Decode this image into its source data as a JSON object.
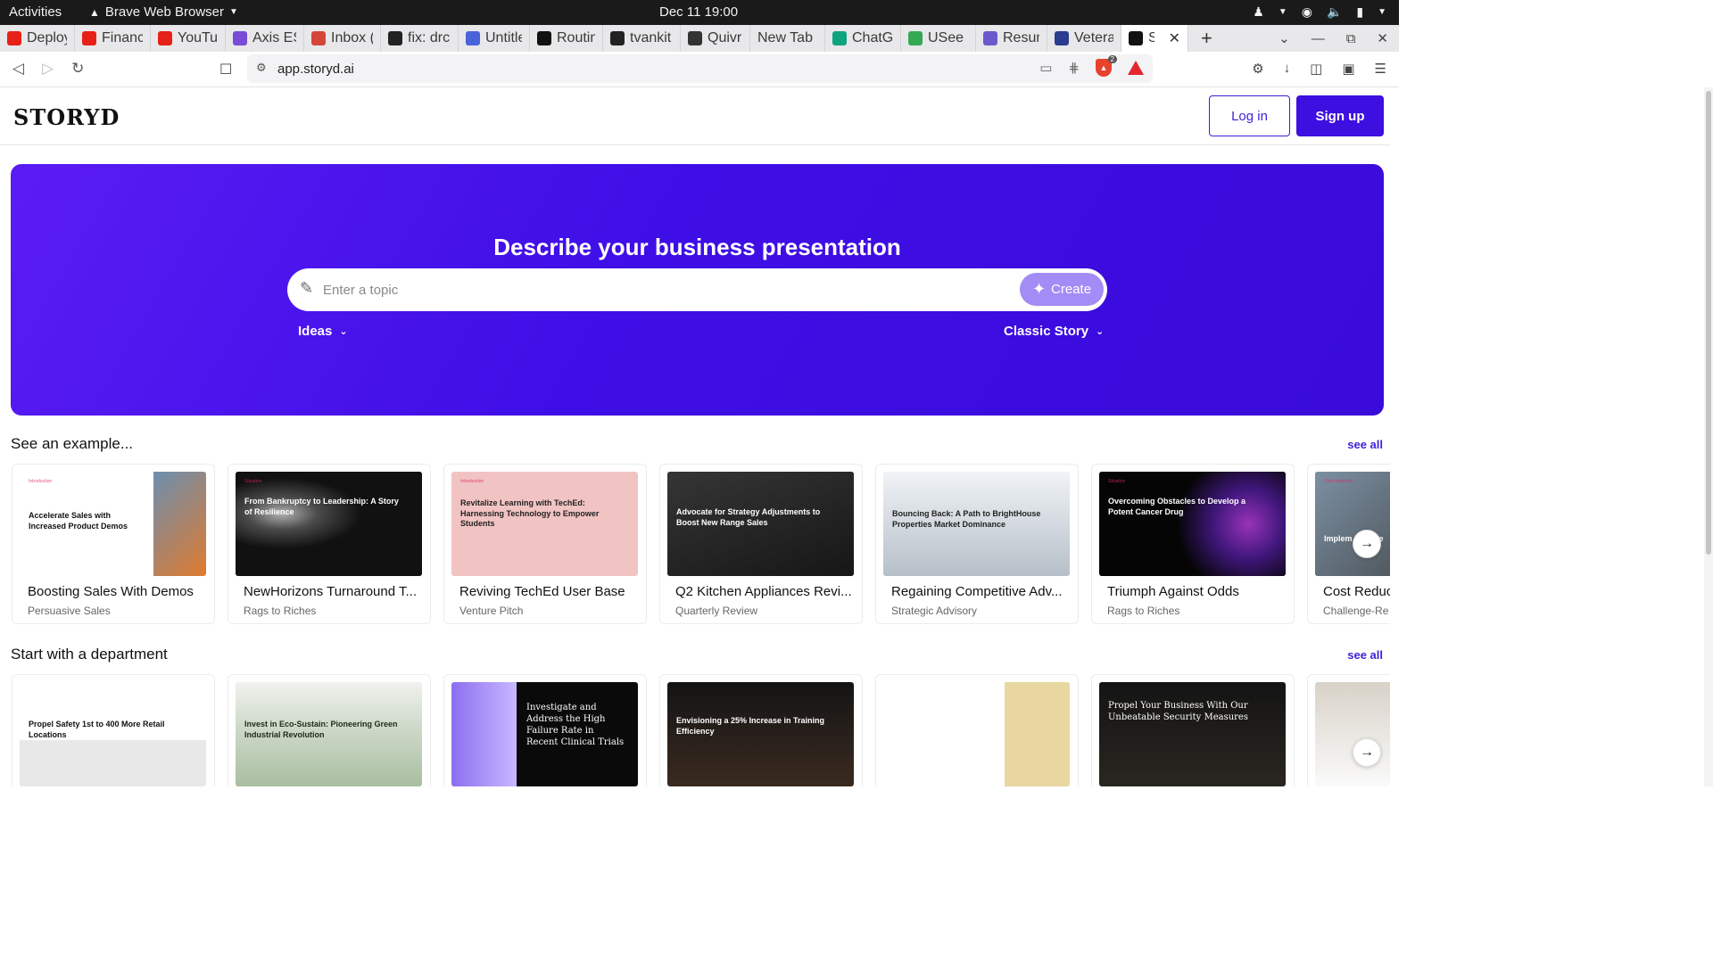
{
  "os": {
    "activities": "Activities",
    "app_name": "Brave Web Browser",
    "clock": "Dec 11  19:00"
  },
  "tabs": [
    {
      "label": "Deploy",
      "fav_color": "#e62117"
    },
    {
      "label": "Financ",
      "fav_color": "#e62117"
    },
    {
      "label": "YouTul",
      "fav_color": "#e62117"
    },
    {
      "label": "Axis ES",
      "fav_color": "#7a4bd6"
    },
    {
      "label": "Inbox (",
      "fav_color": "#d44638"
    },
    {
      "label": "fix: drc",
      "fav_color": "#222222"
    },
    {
      "label": "Untitle",
      "fav_color": "#4a63d8"
    },
    {
      "label": "Routin",
      "fav_color": "#111111"
    },
    {
      "label": "tvankit",
      "fav_color": "#222222"
    },
    {
      "label": "Quivr -",
      "fav_color": "#333333"
    },
    {
      "label": "New Tab",
      "fav_color": ""
    },
    {
      "label": "ChatGI",
      "fav_color": "#10a37f"
    },
    {
      "label": "USee S",
      "fav_color": "#34a853"
    },
    {
      "label": "Resum",
      "fav_color": "#6a5acd"
    },
    {
      "label": "Vetera",
      "fav_color": "#2a3d8f"
    },
    {
      "label": "STC",
      "fav_color": "#111111",
      "active": true
    }
  ],
  "address": {
    "url": "app.storyd.ai"
  },
  "header": {
    "logo": "STORYD",
    "login": "Log in",
    "signup": "Sign up"
  },
  "hero": {
    "title": "Describe your business presentation",
    "placeholder": "Enter a topic",
    "create": "Create",
    "ideas": "Ideas",
    "style": "Classic Story"
  },
  "examples": {
    "title": "See an example...",
    "see_all": "see all",
    "cards": [
      {
        "title": "Boosting Sales With Demos",
        "subtitle": "Persuasive Sales",
        "thumb_text": "Accelerate Sales with Increased Product Demos",
        "tag": "Introduction"
      },
      {
        "title": "NewHorizons Turnaround T...",
        "subtitle": "Rags to Riches",
        "thumb_text": "From Bankruptcy to Leadership: A Story of Resilience",
        "tag": "Situation"
      },
      {
        "title": "Reviving TechEd User Base",
        "subtitle": "Venture Pitch",
        "thumb_text": "Revitalize Learning with TechEd: Harnessing Technology to Empower Students",
        "tag": "Introduction"
      },
      {
        "title": "Q2 Kitchen Appliances Revi...",
        "subtitle": "Quarterly Review",
        "thumb_text": "Advocate for Strategy Adjustments to Boost New Range Sales",
        "tag": ""
      },
      {
        "title": "Regaining Competitive Adv...",
        "subtitle": "Strategic Advisory",
        "thumb_text": "Bouncing Back: A Path to BrightHouse Properties Market Dominance",
        "tag": ""
      },
      {
        "title": "Triumph Against Odds",
        "subtitle": "Rags to Riches",
        "thumb_text": "Overcoming Obstacles to Develop a Potent Cancer Drug",
        "tag": "Situation"
      },
      {
        "title": "Cost Reduc",
        "subtitle": "Challenge-Re",
        "thumb_text": "Implem Reduce",
        "tag": "Cost reduction"
      }
    ]
  },
  "departments": {
    "title": "Start with a department",
    "see_all": "see all",
    "cards": [
      {
        "thumb_text": "Propel Safety 1st to 400 More Retail Locations"
      },
      {
        "thumb_text": "Invest in Eco-Sustain: Pioneering Green Industrial Revolution"
      },
      {
        "thumb_text": "Investigate and Address the High Failure Rate in Recent Clinical Trials"
      },
      {
        "thumb_text": "Envisioning a 25% Increase in Training Efficiency"
      },
      {
        "thumb_text": ""
      },
      {
        "thumb_text": "Propel Your Business With Our Unbeatable Security Measures"
      },
      {
        "thumb_text": ""
      }
    ]
  },
  "icons": {
    "arrow_next": "→"
  }
}
